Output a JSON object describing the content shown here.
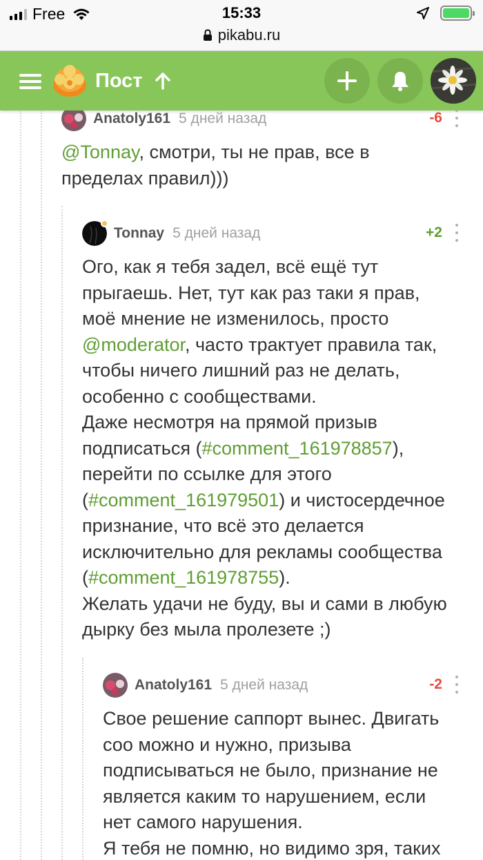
{
  "status_bar": {
    "carrier": "Free",
    "time": "15:33",
    "url": "pikabu.ru"
  },
  "header": {
    "title": "Пост",
    "brand_color": "#88c65a",
    "icons": [
      "menu-icon",
      "pikabu-logo",
      "arrow-up-icon",
      "plus-icon",
      "bell-icon",
      "user-avatar"
    ]
  },
  "comments": [
    {
      "author": "Anatoly161",
      "time": "5 дней назад",
      "rating": "-6",
      "body": [
        {
          "mention": "@Tonnay"
        },
        {
          "text": ", смотри, ты не прав, все в"
        },
        {
          "br": true
        },
        {
          "text": "пределах правил)))"
        }
      ]
    },
    {
      "author": "Tonnay",
      "time": "5 дней назад",
      "rating": "+2",
      "body": [
        {
          "text": "Ого, как я тебя задел, всё ещё тут"
        },
        {
          "br": true
        },
        {
          "text": "прыгаешь. Нет, тут как раз таки я прав,"
        },
        {
          "br": true
        },
        {
          "text": "моё мнение не изменилось, просто"
        },
        {
          "br": true
        },
        {
          "mention": "@moderator"
        },
        {
          "text": ", часто трактует правила так,"
        },
        {
          "br": true
        },
        {
          "text": "чтобы ничего лишний раз не делать,"
        },
        {
          "br": true
        },
        {
          "text": "особенно с сообществами."
        },
        {
          "br": true
        },
        {
          "text": "Даже несмотря на прямой призыв"
        },
        {
          "br": true
        },
        {
          "text": "подписаться ("
        },
        {
          "mention": "#comment_161978857"
        },
        {
          "text": "),"
        },
        {
          "br": true
        },
        {
          "text": "перейти по ссылке для этого"
        },
        {
          "br": true
        },
        {
          "text": "("
        },
        {
          "mention": "#comment_161979501"
        },
        {
          "text": ") и чистосердечное"
        },
        {
          "br": true
        },
        {
          "text": "признание, что всё это делается"
        },
        {
          "br": true
        },
        {
          "text": "исключительно для рекламы сообщества"
        },
        {
          "br": true
        },
        {
          "text": "("
        },
        {
          "mention": "#comment_161978755"
        },
        {
          "text": ")."
        },
        {
          "br": true
        },
        {
          "text": "Желать удачи не буду, вы и сами в любую"
        },
        {
          "br": true
        },
        {
          "text": "дырку без мыла пролезете ;)"
        }
      ]
    },
    {
      "author": "Anatoly161",
      "time": "5 дней назад",
      "rating": "-2",
      "body": [
        {
          "text": "Свое решение саппорт вынес. Двигать"
        },
        {
          "br": true
        },
        {
          "text": "соо можно и нужно, призыва"
        },
        {
          "br": true
        },
        {
          "text": "подписываться не было, признание не"
        },
        {
          "br": true
        },
        {
          "text": "является каким то нарушением, если"
        },
        {
          "br": true
        },
        {
          "text": "нет самого нарушения."
        },
        {
          "br": true
        },
        {
          "text": "Я тебя не помню, но видимо зря, таких"
        }
      ]
    }
  ]
}
